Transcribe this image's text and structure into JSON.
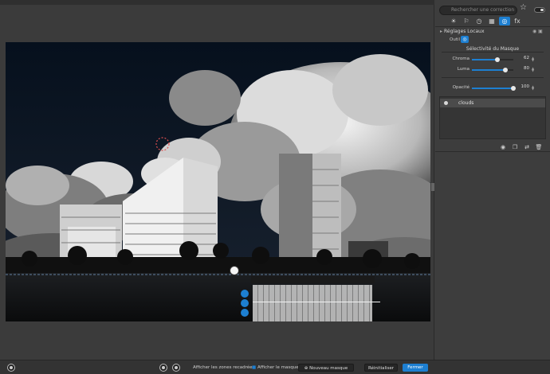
{
  "search": {
    "placeholder": "Rechercher une correction"
  },
  "tabs": [
    {
      "icon": "sun-icon",
      "glyph": "☀"
    },
    {
      "icon": "lock-icon",
      "glyph": "⚐"
    },
    {
      "icon": "history-icon",
      "glyph": "◷"
    },
    {
      "icon": "grid-icon",
      "glyph": "▦"
    },
    {
      "icon": "local-adjust-icon",
      "glyph": "◎"
    },
    {
      "icon": "fx-icon",
      "glyph": "fx"
    }
  ],
  "section": {
    "title": "Réglages Locaux",
    "tool_label": "Outil",
    "mask_title": "Sélectivité du Masque"
  },
  "sliders": [
    {
      "label": "Chroma",
      "value": "62",
      "fraction": 0.62
    },
    {
      "label": "Luma",
      "value": "80",
      "fraction": 0.8
    },
    {
      "label": "Opacité",
      "value": "100",
      "fraction": 1.0
    }
  ],
  "masks": [
    {
      "name": "clouds"
    }
  ],
  "panel_tools": [
    "eye-icon",
    "copy-icon",
    "swap-icon",
    "trash-icon"
  ],
  "bottom": {
    "show_crop": "Afficher les zones recadrées",
    "show_mask": "Afficher le masque",
    "new_mask": "Nouveau masque",
    "reset": "Réinitialiser",
    "close": "Fermer"
  },
  "colors": {
    "accent": "#1d7fd1",
    "panel_bg": "#3d3d3d",
    "viewer_bg": "#3b3b3b",
    "sky": "#0b1422"
  }
}
